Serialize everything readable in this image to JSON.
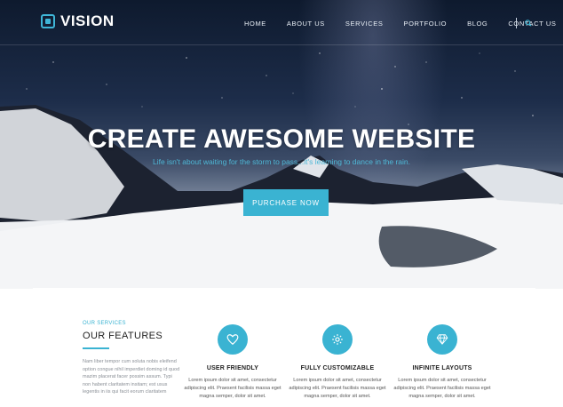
{
  "brand": {
    "name": "VISION",
    "accent": "#3ab3d2"
  },
  "nav": {
    "items": [
      "HOME",
      "ABOUT US",
      "SERVICES",
      "PORTFOLIO",
      "BLOG",
      "CONTACT US"
    ],
    "search_icon": "search-icon"
  },
  "hero": {
    "headline": "CREATE AWESOME WEBSITE",
    "subline": "Life isn't about waiting for the storm to pass...it's learning to dance in the rain.",
    "cta_label": "PURCHASE NOW"
  },
  "services": {
    "label": "OUR SERVICES",
    "title": "OUR FEATURES",
    "description": "Nam liber tempor cum soluta nobis eleifend option congue nihil imperdiet doming id quod mazim placerat facer possim assum. Typi non habent claritatem insitam; est usus legentis in iis qui facit eorum claritatem"
  },
  "features": [
    {
      "icon": "heart-icon",
      "title": "USER FRIENDLY",
      "text": "Lorem ipsum dolor sit amet, consectetur adipiscing elit. Praesent facilisis massa eget magna semper, dolor sit amet."
    },
    {
      "icon": "gear-icon",
      "title": "FULLY CUSTOMIZABLE",
      "text": "Lorem ipsum dolor sit amet, consectetur adipiscing elit. Praesent facilisis massa eget magna semper, dolor sit amet."
    },
    {
      "icon": "diamond-icon",
      "title": "INFINITE LAYOUTS",
      "text": "Lorem ipsum dolor sit amet, consectetur adipiscing elit. Praesent facilisis massa eget magna semper, dolor sit amet."
    }
  ]
}
